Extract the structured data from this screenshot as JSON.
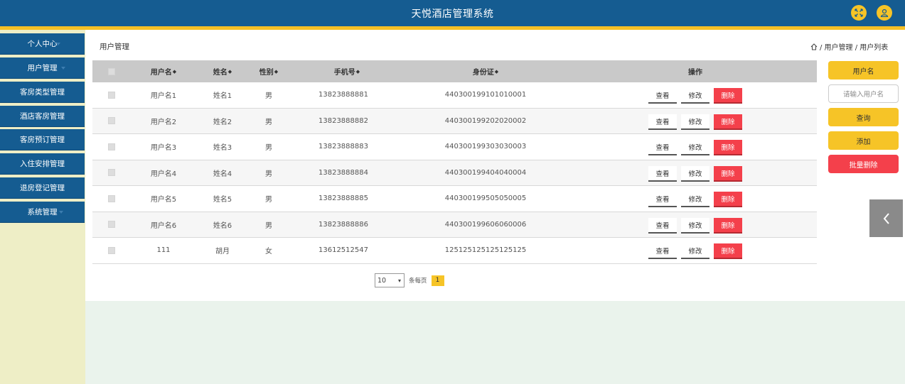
{
  "app": {
    "title": "天悦酒店管理系统"
  },
  "header": {
    "expand_icon": "expand-icon",
    "user_icon": "user-icon",
    "accent": "#f6c427",
    "bg": "#155c91"
  },
  "sidebar": {
    "items": [
      {
        "label": "个人中心"
      },
      {
        "label": "用户管理"
      },
      {
        "label": "客房类型管理"
      },
      {
        "label": "酒店客房管理"
      },
      {
        "label": "客房预订管理"
      },
      {
        "label": "入住安排管理"
      },
      {
        "label": "退房登记管理"
      },
      {
        "label": "系统管理"
      }
    ]
  },
  "page": {
    "title": "用户管理",
    "breadcrumb": "/ 用户管理 / 用户列表"
  },
  "table": {
    "headers": {
      "username": "用户名",
      "name": "姓名",
      "gender": "性别",
      "phone": "手机号",
      "idcard": "身份证",
      "ops": "操作"
    },
    "sort_glyph": "◆",
    "rows": [
      {
        "username": "用户名1",
        "name": "姓名1",
        "gender": "男",
        "phone": "13823888881",
        "idcard": "440300199101010001"
      },
      {
        "username": "用户名2",
        "name": "姓名2",
        "gender": "男",
        "phone": "13823888882",
        "idcard": "440300199202020002"
      },
      {
        "username": "用户名3",
        "name": "姓名3",
        "gender": "男",
        "phone": "13823888883",
        "idcard": "440300199303030003"
      },
      {
        "username": "用户名4",
        "name": "姓名4",
        "gender": "男",
        "phone": "13823888884",
        "idcard": "440300199404040004"
      },
      {
        "username": "用户名5",
        "name": "姓名5",
        "gender": "男",
        "phone": "13823888885",
        "idcard": "440300199505050005"
      },
      {
        "username": "用户名6",
        "name": "姓名6",
        "gender": "男",
        "phone": "13823888886",
        "idcard": "440300199606060006"
      },
      {
        "username": "111",
        "name": "胡月",
        "gender": "女",
        "phone": "13612512547",
        "idcard": "125125125125125125"
      }
    ],
    "op_labels": {
      "view": "查看",
      "edit": "修改",
      "delete": "删除"
    }
  },
  "pagination": {
    "page_size": "10",
    "per_page_label": "条每页",
    "current_page": "1"
  },
  "right_panel": {
    "username_label": "用户名",
    "username_placeholder": "请输入用户名",
    "search_label": "查询",
    "add_label": "添加",
    "batch_delete_label": "批量删除"
  }
}
